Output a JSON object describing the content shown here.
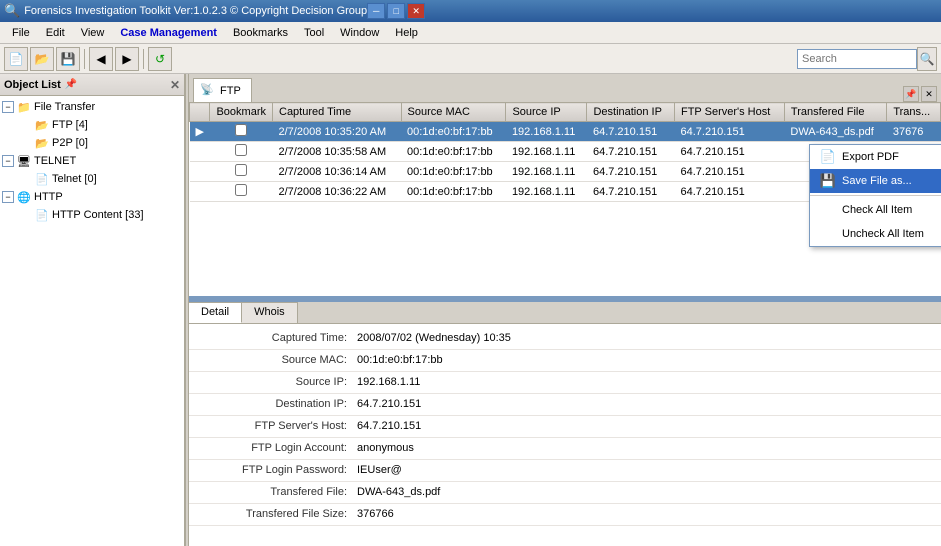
{
  "titlebar": {
    "title": "Forensics Investigation Toolkit    Ver:1.0.2.3    © Copyright Decision Group",
    "win_minimize": "─",
    "win_maximize": "□",
    "win_close": "✕"
  },
  "menubar": {
    "items": [
      "File",
      "Edit",
      "View",
      "Case Management",
      "Bookmarks",
      "Tool",
      "Window",
      "Help"
    ]
  },
  "toolbar": {
    "search_placeholder": "Search"
  },
  "left_panel": {
    "header": "Object List",
    "tree": [
      {
        "level": 0,
        "icon": "📁",
        "label": "File Transfer",
        "expanded": true
      },
      {
        "level": 1,
        "icon": "📂",
        "label": "FTP [4]",
        "expanded": false
      },
      {
        "level": 1,
        "icon": "📂",
        "label": "P2P [0]",
        "expanded": false
      },
      {
        "level": 0,
        "icon": "🖥",
        "label": "TELNET",
        "expanded": true
      },
      {
        "level": 1,
        "icon": "📄",
        "label": "Telnet [0]",
        "expanded": false
      },
      {
        "level": 0,
        "icon": "🌐",
        "label": "HTTP",
        "expanded": true
      },
      {
        "level": 1,
        "icon": "📄",
        "label": "HTTP Content [33]",
        "expanded": false
      }
    ]
  },
  "ftp_tab": {
    "label": "FTP",
    "columns": [
      "Bookmark",
      "Captured Time",
      "Source MAC",
      "Source IP",
      "Destination IP",
      "FTP Server's Host",
      "Transfered File",
      "Trans..."
    ],
    "rows": [
      {
        "selected": true,
        "arrow": "▶",
        "bookmark": false,
        "captured_time": "2/7/2008 10:35:20 AM",
        "source_mac": "00:1d:e0:bf:17:bb",
        "source_ip": "192.168.1.11",
        "dest_ip": "64.7.210.151",
        "ftp_host": "64.7.210.151",
        "transfered_file": "DWA-643_ds.pdf",
        "trans": "37676"
      },
      {
        "selected": false,
        "arrow": "",
        "bookmark": false,
        "captured_time": "2/7/2008 10:35:58 AM",
        "source_mac": "00:1d:e0:bf:17:bb",
        "source_ip": "192.168.1.11",
        "dest_ip": "64.7.210.151",
        "ftp_host": "64.7.210.151",
        "transfered_file": "",
        "trans": ""
      },
      {
        "selected": false,
        "arrow": "",
        "bookmark": false,
        "captured_time": "2/7/2008 10:36:14 AM",
        "source_mac": "00:1d:e0:bf:17:bb",
        "source_ip": "192.168.1.11",
        "dest_ip": "64.7.210.151",
        "ftp_host": "64.7.210.151",
        "transfered_file": "",
        "trans": ""
      },
      {
        "selected": false,
        "arrow": "",
        "bookmark": false,
        "captured_time": "2/7/2008 10:36:22 AM",
        "source_mac": "00:1d:e0:bf:17:bb",
        "source_ip": "192.168.1.11",
        "dest_ip": "64.7.210.151",
        "ftp_host": "64.7.210.151",
        "transfered_file": "",
        "trans": ""
      }
    ]
  },
  "context_menu": {
    "items": [
      {
        "icon": "pdf",
        "label": "Export PDF",
        "highlighted": false
      },
      {
        "icon": "save",
        "label": "Save File as...",
        "highlighted": true
      },
      {
        "separator": false
      },
      {
        "icon": "",
        "label": "Check All Item",
        "highlighted": false
      },
      {
        "icon": "",
        "label": "Uncheck All Item",
        "highlighted": false
      }
    ]
  },
  "detail_tabs": {
    "tabs": [
      "Detail",
      "Whois"
    ],
    "active": "Detail"
  },
  "detail_rows": [
    {
      "label": "Captured Time:",
      "value": "2008/07/02 (Wednesday) 10:35"
    },
    {
      "label": "Source MAC:",
      "value": "00:1d:e0:bf:17:bb"
    },
    {
      "label": "Source IP:",
      "value": "192.168.1.11"
    },
    {
      "label": "Destination IP:",
      "value": "64.7.210.151"
    },
    {
      "label": "FTP Server's Host:",
      "value": "64.7.210.151"
    },
    {
      "label": "FTP Login Account:",
      "value": "anonymous"
    },
    {
      "label": "FTP Login Password:",
      "value": "IEUser@"
    },
    {
      "label": "Transfered File:",
      "value": "DWA-643_ds.pdf"
    },
    {
      "label": "Transfered File Size:",
      "value": "376766"
    }
  ]
}
